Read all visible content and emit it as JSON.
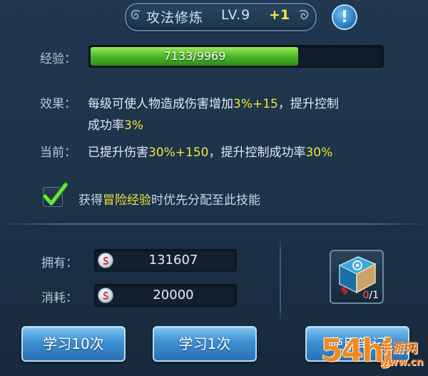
{
  "header": {
    "skill_name": "攻法修炼",
    "level": "LV.9",
    "level_bonus": "+1",
    "info_icon": "exclamation-icon"
  },
  "experience": {
    "label": "经验：",
    "text": "7133/9969",
    "current": 7133,
    "max": 9969
  },
  "effect": {
    "label": "效果：",
    "part1": "每级可使人物造成伤害增加",
    "highlight": "3%+15",
    "part2": "，提升控制",
    "line2_part1": "成功率",
    "line2_highlight": "3%"
  },
  "current": {
    "label": "当前：",
    "part1": "已提升伤害",
    "highlight1": "30%+150",
    "part2": "，提升控制成功率",
    "highlight2": "30%"
  },
  "auto_allocate": {
    "checked": true,
    "part1": "获得",
    "highlight": "冒险经验",
    "part2": "时优先分配至此技能"
  },
  "resources": {
    "owned_label": "拥有：",
    "owned_value": "131607",
    "cost_label": "消耗：",
    "cost_value": "20000"
  },
  "item": {
    "icon": "skill-book-icon",
    "count_current": "0",
    "count_total": "/1"
  },
  "buttons": {
    "learn10": "学习10次",
    "learn1": "学习1次",
    "use_notes": "使用笔记"
  },
  "watermark": {
    "big": "54hj",
    "small": "手游网",
    "url": "www.cn"
  },
  "colors": {
    "highlight": "#f4e23a",
    "exp_bar": "#4cb82a",
    "button": "#3d8fd0",
    "background": "#1d3349"
  }
}
